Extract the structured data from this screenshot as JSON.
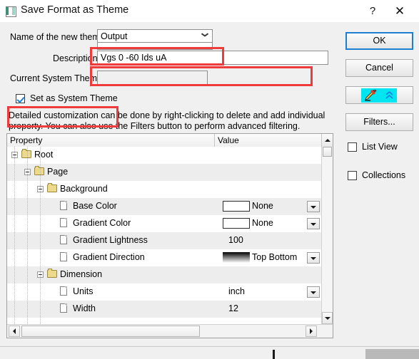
{
  "window": {
    "title": "Save Format as Theme",
    "icon": "theme-app-icon",
    "help_label": "?",
    "close_label": "✕"
  },
  "form": {
    "theme_name_label": "Name of the new theme:",
    "theme_name_value": "Output",
    "description_label": "Description:",
    "description_value": "Vgs 0 -60 Ids uA",
    "description_placeholder": "",
    "current_system_theme_label": "Current System Theme:",
    "current_system_theme_value": "",
    "set_as_system_theme_label": "Set as System Theme",
    "set_as_system_theme_checked": true,
    "hint": "Detailed customization can be done by right-clicking to delete and add individual property. You can also use the Filters button to perform advanced filtering."
  },
  "tree": {
    "columns": [
      "Property",
      "Value"
    ],
    "rows": [
      {
        "label": "Root",
        "indent": 0,
        "type": "folder",
        "value": "",
        "has_swatch": false,
        "has_dropdown": false
      },
      {
        "label": "Page",
        "indent": 1,
        "type": "folder",
        "value": "",
        "has_swatch": false,
        "has_dropdown": false
      },
      {
        "label": "Background",
        "indent": 2,
        "type": "folder",
        "value": "",
        "has_swatch": false,
        "has_dropdown": false
      },
      {
        "label": "Base Color",
        "indent": 3,
        "type": "page",
        "value": "None",
        "has_swatch": true,
        "swatch": "#ffffff",
        "has_dropdown": true
      },
      {
        "label": "Gradient Color",
        "indent": 3,
        "type": "page",
        "value": "None",
        "has_swatch": true,
        "swatch": "#ffffff",
        "has_dropdown": true
      },
      {
        "label": "Gradient Lightness",
        "indent": 3,
        "type": "page",
        "value": "100",
        "has_swatch": false,
        "has_dropdown": false
      },
      {
        "label": "Gradient Direction",
        "indent": 3,
        "type": "page",
        "value": "Top Bottom",
        "has_swatch": true,
        "swatch": "gradient",
        "has_dropdown": true
      },
      {
        "label": "Dimension",
        "indent": 2,
        "type": "folder",
        "value": "",
        "has_swatch": false,
        "has_dropdown": false
      },
      {
        "label": "Units",
        "indent": 3,
        "type": "page",
        "value": "inch",
        "has_swatch": false,
        "has_dropdown": true
      },
      {
        "label": "Width",
        "indent": 3,
        "type": "page",
        "value": "12",
        "has_swatch": false,
        "has_dropdown": false
      }
    ]
  },
  "buttons": {
    "ok": "OK",
    "cancel": "Cancel",
    "edit_icon": "pencil-edit-icon",
    "filters": "Filters..."
  },
  "options": {
    "list_view_label": "List View",
    "list_view_checked": false,
    "collections_label": "Collections",
    "collections_checked": false
  },
  "colors": {
    "accent": "#1d7fd0",
    "annotation": "#ef3b3b",
    "icon_background": "#00e5f0",
    "folder": "#ecd98a",
    "dialog_background": "#f0f0f0"
  }
}
